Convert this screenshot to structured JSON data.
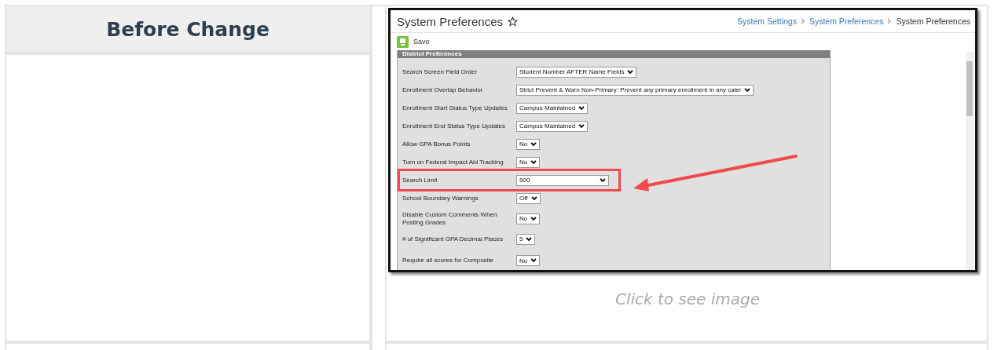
{
  "table": {
    "header": "Before Change",
    "caption": "Click to see image"
  },
  "window": {
    "title": "System Preferences",
    "favorite": false,
    "breadcrumbs": [
      {
        "label": "System Settings",
        "link": true
      },
      {
        "label": "System Preferences",
        "link": true
      },
      {
        "label": "System Preferences",
        "link": false
      }
    ],
    "toolbar": {
      "save": "Save"
    },
    "section": "District Preferences",
    "rows": [
      {
        "label": "Search Screen Field Order",
        "value": "Student Number AFTER Name Fields",
        "highlighted": false
      },
      {
        "label": "Enrollment Overlap Behavior",
        "value": "Strict Prevent & Warn Non-Primary: Prevent any primary enrollment in any caler",
        "highlighted": false
      },
      {
        "label": "Enrollment Start Status Type Updates",
        "value": "Campus Maintained",
        "highlighted": false
      },
      {
        "label": "Enrollment End Status Type Updates",
        "value": "Campus Maintained",
        "highlighted": false
      },
      {
        "label": "Allow GPA Bonus Points",
        "value": "No",
        "highlighted": false
      },
      {
        "label": "Turn on Federal Impact Aid Tracking",
        "value": "No",
        "highlighted": false
      },
      {
        "label": "Search Limit",
        "value": "500",
        "highlighted": true
      },
      {
        "label": "School Boundary Warnings",
        "value": "Off",
        "highlighted": false
      },
      {
        "label": "Disable Custom Comments When Posting Grades",
        "value": "No",
        "highlighted": false
      },
      {
        "label": "# of Significant GPA Decimal Places",
        "value": "5",
        "highlighted": false
      },
      {
        "label": "Require all scores for Composite",
        "value": "No",
        "highlighted": false
      }
    ]
  }
}
